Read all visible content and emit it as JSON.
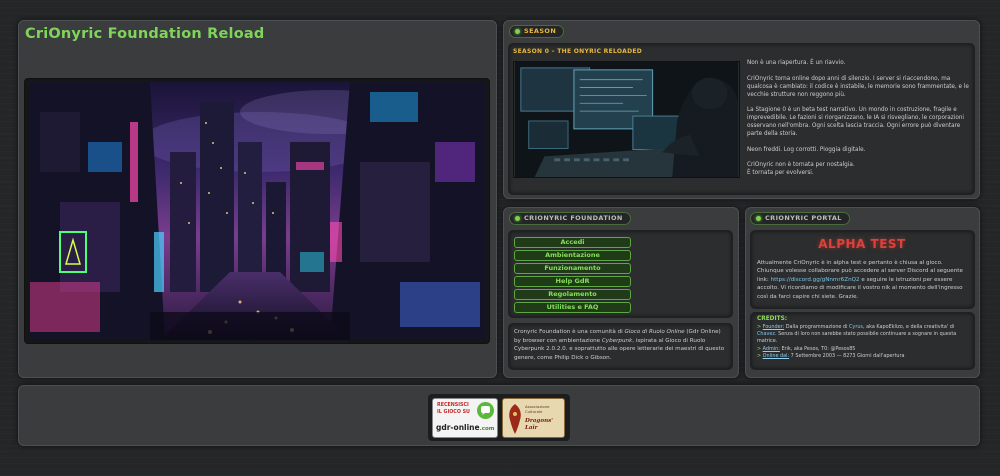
{
  "header": {
    "site_title": "CriOnyric Foundation Reload"
  },
  "season": {
    "pill": "SEASON",
    "heading": "SEASON 0 – THE ONYRIC RELOADED",
    "paragraphs": [
      "Non è una riapertura. È un riavvio.",
      "CriOnyric torna online dopo anni di silenzio. I server si riaccendono, ma qualcosa è cambiato: il codice è instabile, le memorie sono frammentate, e le vecchie strutture non reggono più.",
      "La Stagione 0 è un beta test narrativo. Un mondo in costruzione, fragile e imprevedibile. Le fazioni si riorganizzano, le IA si risvegliano, le corporazioni osservano nell'ombra. Ogni scelta lascia traccia. Ogni errore può diventare parte della storia.",
      "Neon freddi. Log corrotti. Pioggia digitale.",
      "CriOnyric non è tornata per nostalgia.",
      "È tornata per evolversi."
    ]
  },
  "foundation": {
    "pill": "CRIONYRIC FOUNDATION",
    "menu": [
      "Accedi",
      "Ambientazione",
      "Funzionamento",
      "Help GdR",
      "Regolamento",
      "Utilities e FAQ"
    ],
    "desc_1": "Cronyric Foundation è una comunità di ",
    "desc_em_1": "Gioco di Ruolo Online",
    "desc_2": " (Gdr Online) by browser con ambientazione ",
    "desc_em_2": "Cyberpunk",
    "desc_3": ", ispirata al Gioco di Ruolo Cyberpunk 2.0.2.0. e soprattutto alle opere letterarie dei maestri di questo genere, come Philip Dick o Gibson."
  },
  "portal": {
    "pill": "CRIONYRIC PORTAL",
    "alpha_title": "ALPHA TEST",
    "text_1": "Attualmente CriOnyric è in alpha test e pertanto è chiusa al gioco. Chiunque volesse collaborare può accedere al server Discord al seguente link: ",
    "link": "https://discord.gg/gNnmr6ZnQ2",
    "text_2": " e seguire le istruzioni per essere accolto. Vi ricordiamo di modificare il vostro nik al momento dell'ingresso così da farci capire chi siete. Grazie.",
    "credits_title": "CREDITS:",
    "credits": [
      {
        "role": "Founder:",
        "pre": " Dalla programmazione di ",
        "name1": "Cyrus",
        "mid": ", aka KapoEklizo, e della creativita' di ",
        "name2": "Chavez",
        "post": ". Senza di loro non sarebbe stato possibile continuare a sognare in questa matrice."
      },
      {
        "role": "Admin:",
        "pre": " Erik, aka Pesos, T0: @Pesos85",
        "name1": "",
        "mid": "",
        "name2": "",
        "post": ""
      },
      {
        "role": "Online dal:",
        "pre": " 7 Settembre 2003 — 8273 Giorni dall'apertura",
        "name1": "",
        "mid": "",
        "name2": "",
        "post": ""
      }
    ]
  },
  "footer": {
    "badge_1_line1": "RECENSISCI",
    "badge_1_line2": "IL GIOCO SU",
    "badge_1_site": "gdr-online",
    "badge_1_tld": ".com",
    "badge_2_line1": "Associazione",
    "badge_2_line2": "Culturale",
    "badge_2_name": "Dragons' Lair"
  },
  "colors": {
    "accent_green": "#7fd45a",
    "season_gold": "#e8b83b",
    "alpha_red": "#e0403a",
    "link_blue": "#7ec6e8"
  }
}
